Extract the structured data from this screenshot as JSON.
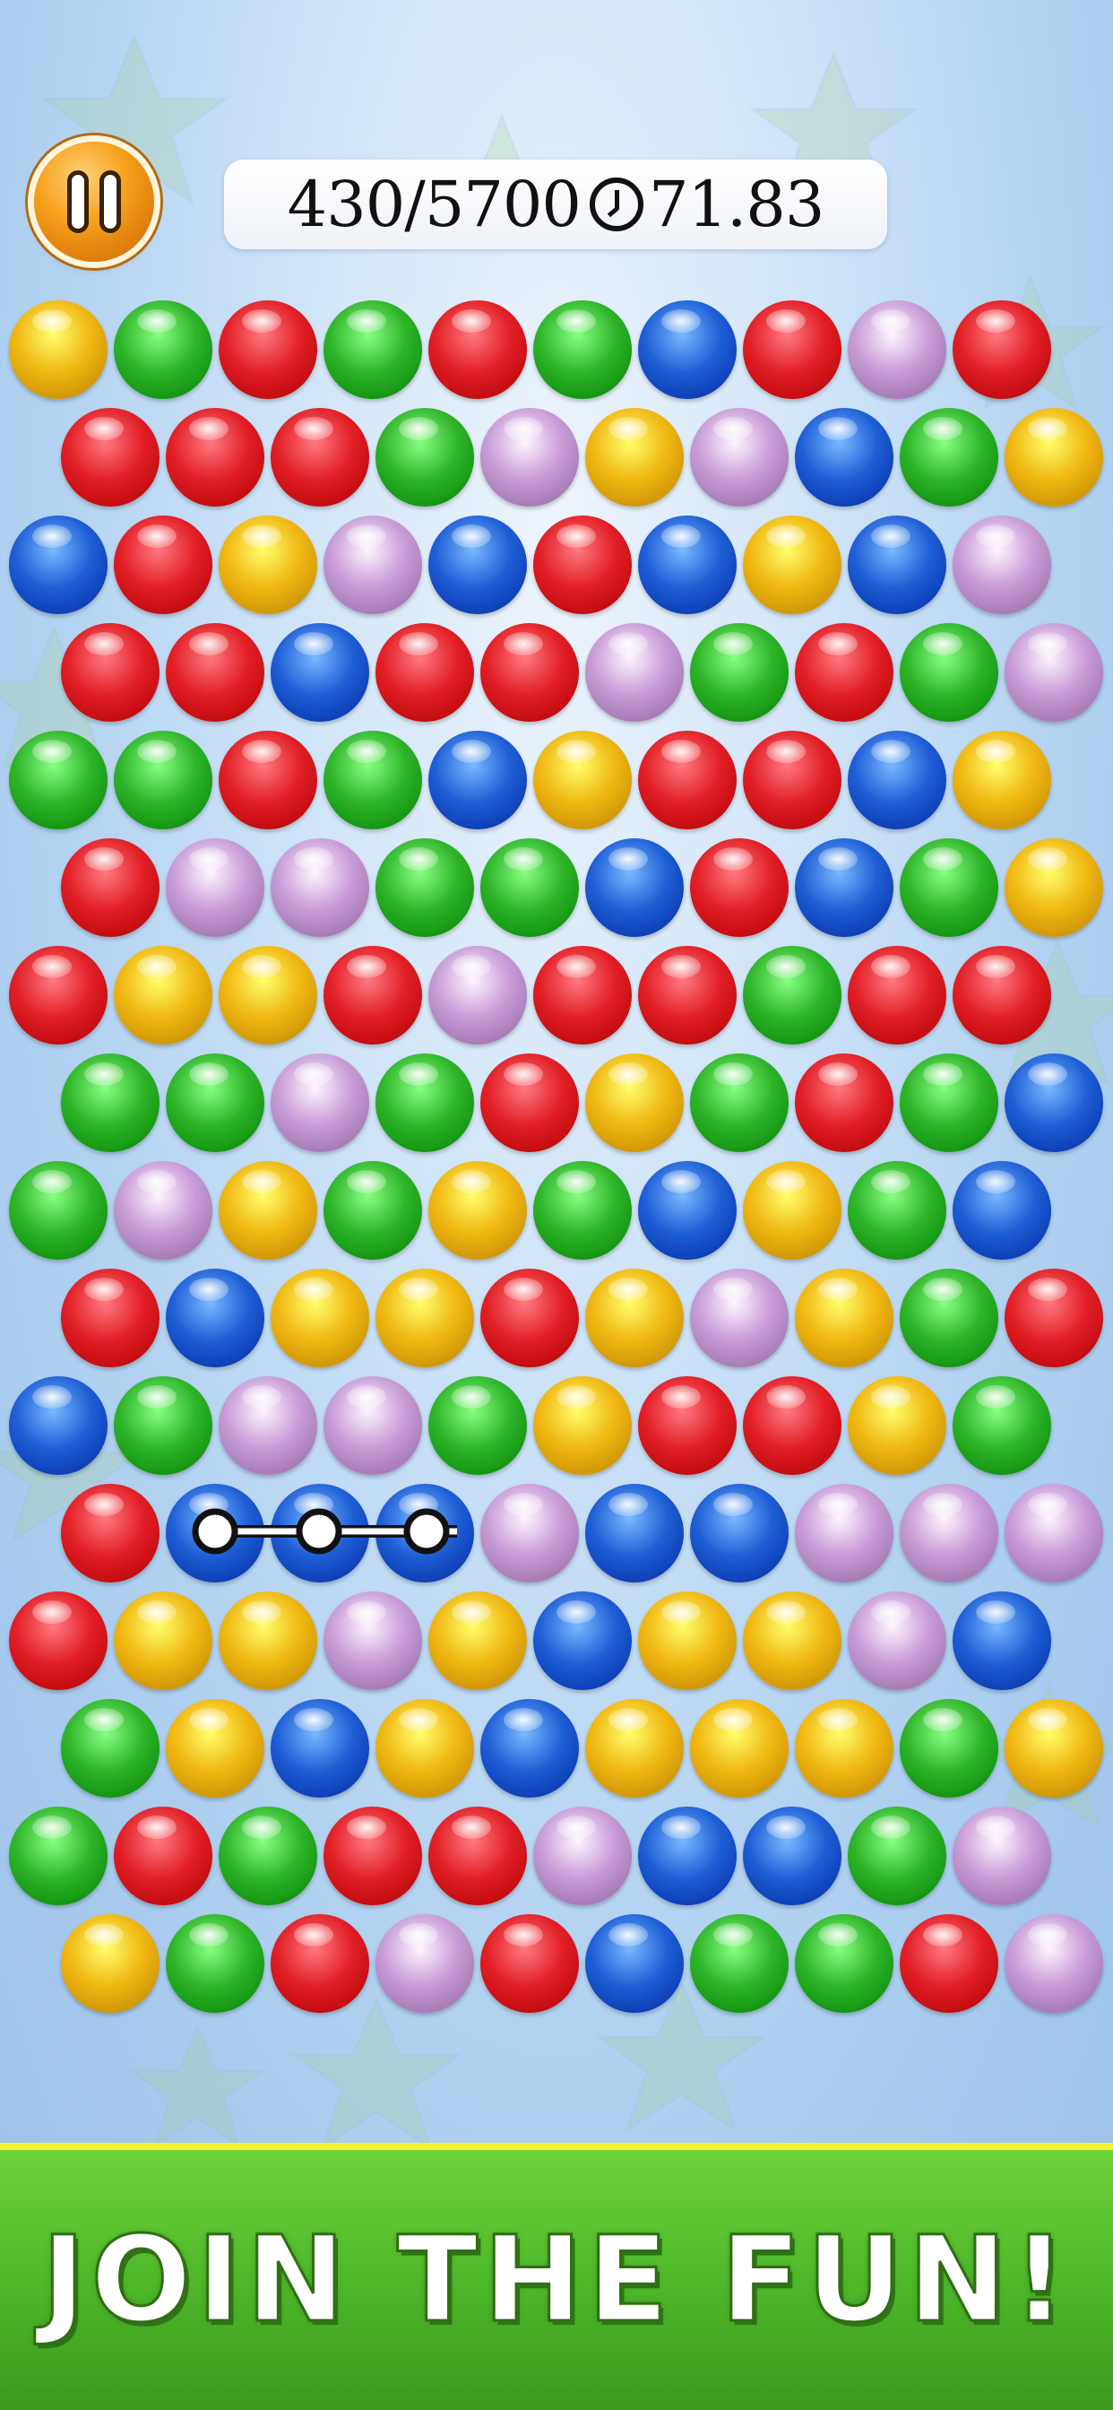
{
  "hud": {
    "score": "430/5700",
    "timer": "71.83",
    "pause_icon": "pause-icon",
    "clock_icon": "clock-icon"
  },
  "colors": {
    "Y": "#f0b712",
    "G": "#2fb52a",
    "R": "#e21f26",
    "B": "#1f5fd6",
    "P": "#c79bd6"
  },
  "board": {
    "rows": [
      [
        "Y",
        "G",
        "R",
        "G",
        "R",
        "G",
        "B",
        "R",
        "P",
        "R"
      ],
      [
        "R",
        "R",
        "R",
        "G",
        "P",
        "Y",
        "P",
        "B",
        "G",
        "Y"
      ],
      [
        "B",
        "R",
        "Y",
        "P",
        "B",
        "R",
        "B",
        "Y",
        "B",
        "P"
      ],
      [
        "R",
        "R",
        "B",
        "R",
        "R",
        "P",
        "G",
        "R",
        "G",
        "P"
      ],
      [
        "G",
        "G",
        "R",
        "G",
        "B",
        "Y",
        "R",
        "R",
        "B",
        "Y"
      ],
      [
        "R",
        "P",
        "P",
        "G",
        "G",
        "B",
        "R",
        "B",
        "G",
        "Y"
      ],
      [
        "R",
        "Y",
        "Y",
        "R",
        "P",
        "R",
        "R",
        "G",
        "R",
        "R"
      ],
      [
        "G",
        "G",
        "P",
        "G",
        "R",
        "Y",
        "G",
        "R",
        "G",
        "B"
      ],
      [
        "G",
        "P",
        "Y",
        "G",
        "Y",
        "G",
        "B",
        "Y",
        "G",
        "B"
      ],
      [
        "R",
        "B",
        "Y",
        "Y",
        "R",
        "Y",
        "P",
        "Y",
        "G",
        "R"
      ],
      [
        "B",
        "G",
        "P",
        "P",
        "G",
        "Y",
        "R",
        "R",
        "Y",
        "G"
      ],
      [
        "R",
        "B",
        "B",
        "B",
        "P",
        "B",
        "B",
        "P",
        "P",
        "P"
      ],
      [
        "R",
        "Y",
        "Y",
        "P",
        "Y",
        "B",
        "Y",
        "Y",
        "P",
        "B"
      ],
      [
        "G",
        "Y",
        "B",
        "Y",
        "B",
        "Y",
        "Y",
        "Y",
        "G",
        "Y"
      ],
      [
        "G",
        "R",
        "G",
        "R",
        "R",
        "P",
        "B",
        "B",
        "G",
        "P"
      ],
      [
        "Y",
        "G",
        "R",
        "P",
        "R",
        "B",
        "G",
        "G",
        "R",
        "P"
      ]
    ],
    "selected_link": {
      "row": 11,
      "from_col": 1,
      "to_col": 3
    }
  },
  "footer": {
    "label": "JOIN THE FUN!"
  }
}
